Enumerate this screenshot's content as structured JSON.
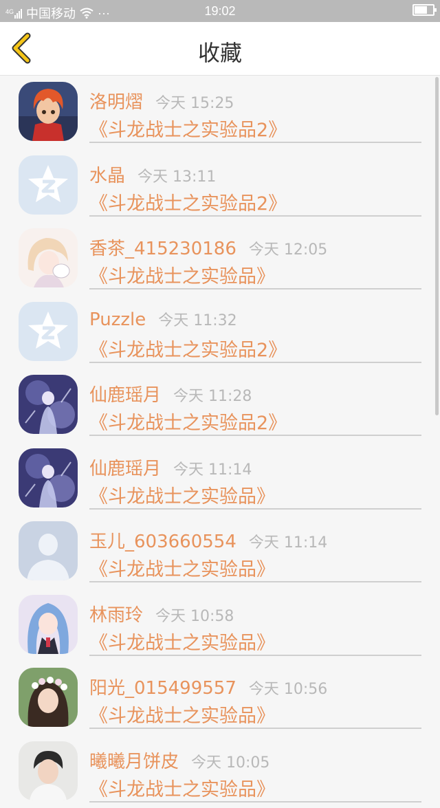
{
  "status": {
    "carrier": "中国移动",
    "dots": "···",
    "time": "19:02",
    "signal_icon": "4G signal",
    "wifi_icon": "wifi"
  },
  "nav": {
    "title": "收藏",
    "back_icon": "chevron-left-icon"
  },
  "items": [
    {
      "name": "洛明熠",
      "time": "今天 15:25",
      "title": "《斗龙战士之实验品2》",
      "avatar": "anime-boy-red-hair"
    },
    {
      "name": "水晶",
      "time": "今天 13:11",
      "title": "《斗龙战士之实验品2》",
      "avatar": "qq-default-star"
    },
    {
      "name": "香茶_415230186",
      "time": "今天 12:05",
      "title": "《斗龙战士之实验品》",
      "avatar": "sketch-girl"
    },
    {
      "name": "Puzzle",
      "time": "今天 11:32",
      "title": "《斗龙战士之实验品2》",
      "avatar": "qq-default-star"
    },
    {
      "name": "仙鹿瑶月",
      "time": "今天 11:28",
      "title": "《斗龙战士之实验品2》",
      "avatar": "fantasy-purple"
    },
    {
      "name": "仙鹿瑶月",
      "time": "今天 11:14",
      "title": "《斗龙战士之实验品》",
      "avatar": "fantasy-purple"
    },
    {
      "name": "玉儿_603660554",
      "time": "今天 11:14",
      "title": "《斗龙战士之实验品》",
      "avatar": "default-person"
    },
    {
      "name": "林雨玲",
      "time": "今天 10:58",
      "title": "《斗龙战士之实验品》",
      "avatar": "anime-girl-blue-hair"
    },
    {
      "name": "阳光_015499557",
      "time": "今天 10:56",
      "title": "《斗龙战士之实验品》",
      "avatar": "girl-flower-crown"
    },
    {
      "name": "曦曦月饼皮",
      "time": "今天 10:05",
      "title": "《斗龙战士之实验品》",
      "avatar": "boy-photo"
    }
  ],
  "colors": {
    "accent": "#e8935c",
    "time_gray": "#b8b8b8",
    "background": "#f6f6f6",
    "statusbar": "#b9b9b9",
    "back_icon": "#f5c518"
  }
}
